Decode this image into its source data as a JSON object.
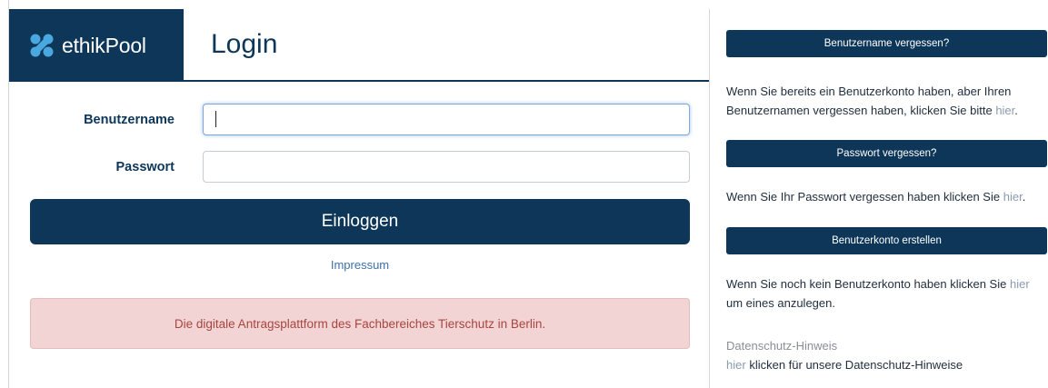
{
  "header": {
    "brand": "ethikPool",
    "title": "Login"
  },
  "form": {
    "username_label": "Benutzername",
    "username_value": "",
    "password_label": "Passwort",
    "password_value": "",
    "login_button": "Einloggen",
    "impressum_link": "Impressum",
    "notice": "Die digitale Antragsplattform des Fachbereiches Tierschutz in Berlin."
  },
  "sidebar": {
    "forgot_username": {
      "button": "Benutzername vergessen?",
      "text": "Wenn Sie bereits ein Benutzerkonto haben, aber Ihren Benutzernamen vergessen haben, klicken Sie bitte",
      "link": "hier",
      "suffix": "."
    },
    "forgot_password": {
      "button": "Passwort vergessen?",
      "text": "Wenn Sie Ihr Passwort vergessen haben klicken Sie",
      "link": "hier",
      "suffix": "."
    },
    "create_account": {
      "button": "Benutzerkonto erstellen",
      "text": "Wenn Sie noch kein Benutzerkonto haben klicken Sie",
      "link": "hier",
      "suffix": "um eines anzulegen."
    },
    "privacy": {
      "heading": "Datenschutz-Hinweis",
      "link": "hier",
      "text": "klicken für unsere Datenschutz-Hinweise"
    }
  },
  "colors": {
    "brand": "#0d3658",
    "alert_bg": "#f2d4d4",
    "alert_text": "#a9443f",
    "link": "#3d73a8"
  },
  "icons": {
    "brand": "ethikpool-logo-icon"
  }
}
